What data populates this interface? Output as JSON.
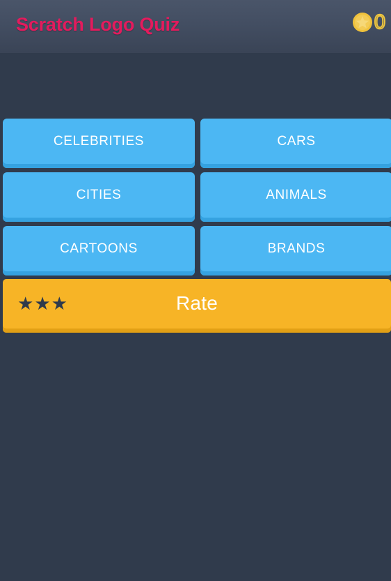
{
  "header": {
    "title": "Scratch Logo Quiz",
    "title_color": "#e31b5d",
    "coin_icon": "coin-star-icon",
    "coin_count": "0",
    "coin_color": "#efc63f"
  },
  "categories": {
    "button_color": "#4cb7f3",
    "items": [
      {
        "label": "CELEBRITIES"
      },
      {
        "label": "CARS"
      },
      {
        "label": "CITIES"
      },
      {
        "label": "ANIMALS"
      },
      {
        "label": "CARTOONS"
      },
      {
        "label": "BRANDS"
      }
    ]
  },
  "rate": {
    "label": "Rate",
    "button_color": "#f7b426",
    "star_color": "#2f3a4b",
    "stars": [
      "★",
      "★",
      "★"
    ]
  },
  "theme": {
    "background": "#303b4c",
    "header_gradient_top": "#4a5569",
    "header_gradient_bottom": "#3a4456"
  }
}
